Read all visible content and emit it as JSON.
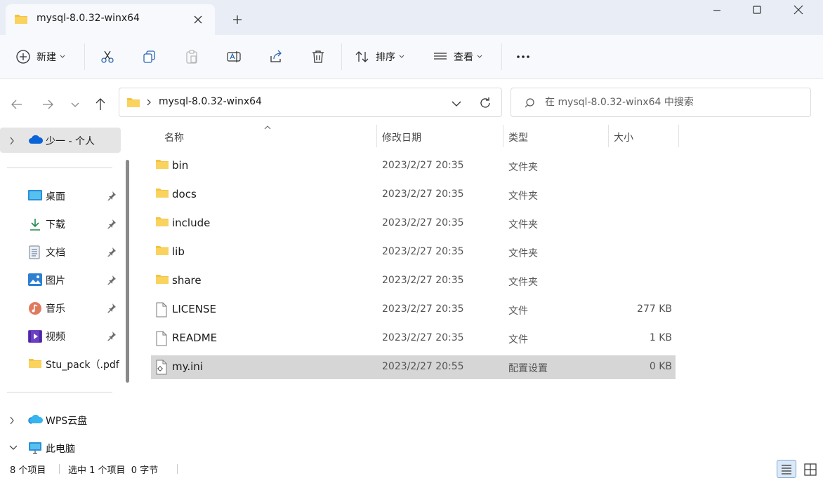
{
  "window": {
    "tab_title": "mysql-8.0.32-winx64"
  },
  "toolbar": {
    "new_label": "新建",
    "sort_label": "排序",
    "view_label": "查看"
  },
  "address": {
    "path": "mysql-8.0.32-winx64"
  },
  "search": {
    "placeholder": "在 mysql-8.0.32-winx64 中搜索"
  },
  "sidebar": {
    "items": [
      {
        "label": "少一 - 个人"
      },
      {
        "label": "桌面"
      },
      {
        "label": "下载"
      },
      {
        "label": "文档"
      },
      {
        "label": "图片"
      },
      {
        "label": "音乐"
      },
      {
        "label": "视频"
      },
      {
        "label": "Stu_pack（.pdf"
      },
      {
        "label": "WPS云盘"
      },
      {
        "label": "此电脑"
      }
    ]
  },
  "columns": {
    "name": "名称",
    "date": "修改日期",
    "type": "类型",
    "size": "大小"
  },
  "files": [
    {
      "name": "bin",
      "date": "2023/2/27 20:35",
      "type": "文件夹",
      "size": ""
    },
    {
      "name": "docs",
      "date": "2023/2/27 20:35",
      "type": "文件夹",
      "size": ""
    },
    {
      "name": "include",
      "date": "2023/2/27 20:35",
      "type": "文件夹",
      "size": ""
    },
    {
      "name": "lib",
      "date": "2023/2/27 20:35",
      "type": "文件夹",
      "size": ""
    },
    {
      "name": "share",
      "date": "2023/2/27 20:35",
      "type": "文件夹",
      "size": ""
    },
    {
      "name": "LICENSE",
      "date": "2023/2/27 20:35",
      "type": "文件",
      "size": "277 KB"
    },
    {
      "name": "README",
      "date": "2023/2/27 20:35",
      "type": "文件",
      "size": "1 KB"
    },
    {
      "name": "my.ini",
      "date": "2023/2/27 20:55",
      "type": "配置设置",
      "size": "0 KB"
    }
  ],
  "status": {
    "count": "8 个项目",
    "selection": "选中 1 个项目  0 字节"
  },
  "colors": {
    "folder": "#f4c343",
    "accent": "#0067c0",
    "selected_row": "#d6d6d6"
  }
}
